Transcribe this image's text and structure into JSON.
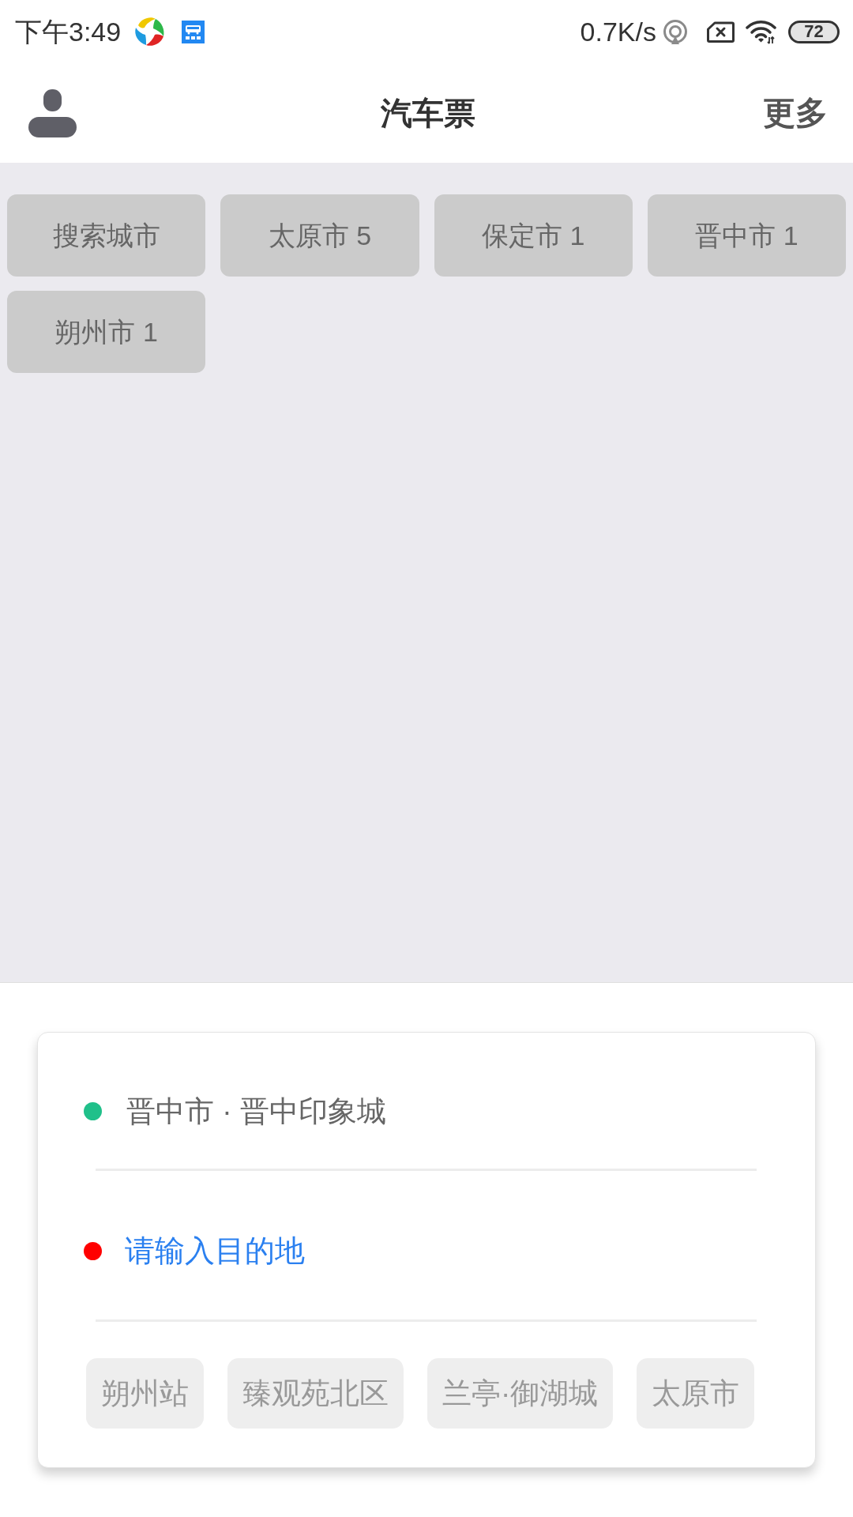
{
  "status_bar": {
    "time": "下午3:49",
    "network_speed": "0.7K/s",
    "battery": "72"
  },
  "header": {
    "title": "汽车票",
    "more": "更多"
  },
  "city_chips": [
    "搜索城市",
    "太原市 5",
    "保定市 1",
    "晋中市 1",
    "朔州市 1"
  ],
  "route": [
    {
      "kind": "origin",
      "color": "#20c08a",
      "value": "晋中市 · 晋中印象城"
    },
    {
      "kind": "destination",
      "color": "#ff0000",
      "placeholder": "请输入目的地"
    }
  ],
  "recent_destinations": [
    "朔州站",
    "臻观苑北区",
    "兰亭·御湖城",
    "太原市"
  ]
}
